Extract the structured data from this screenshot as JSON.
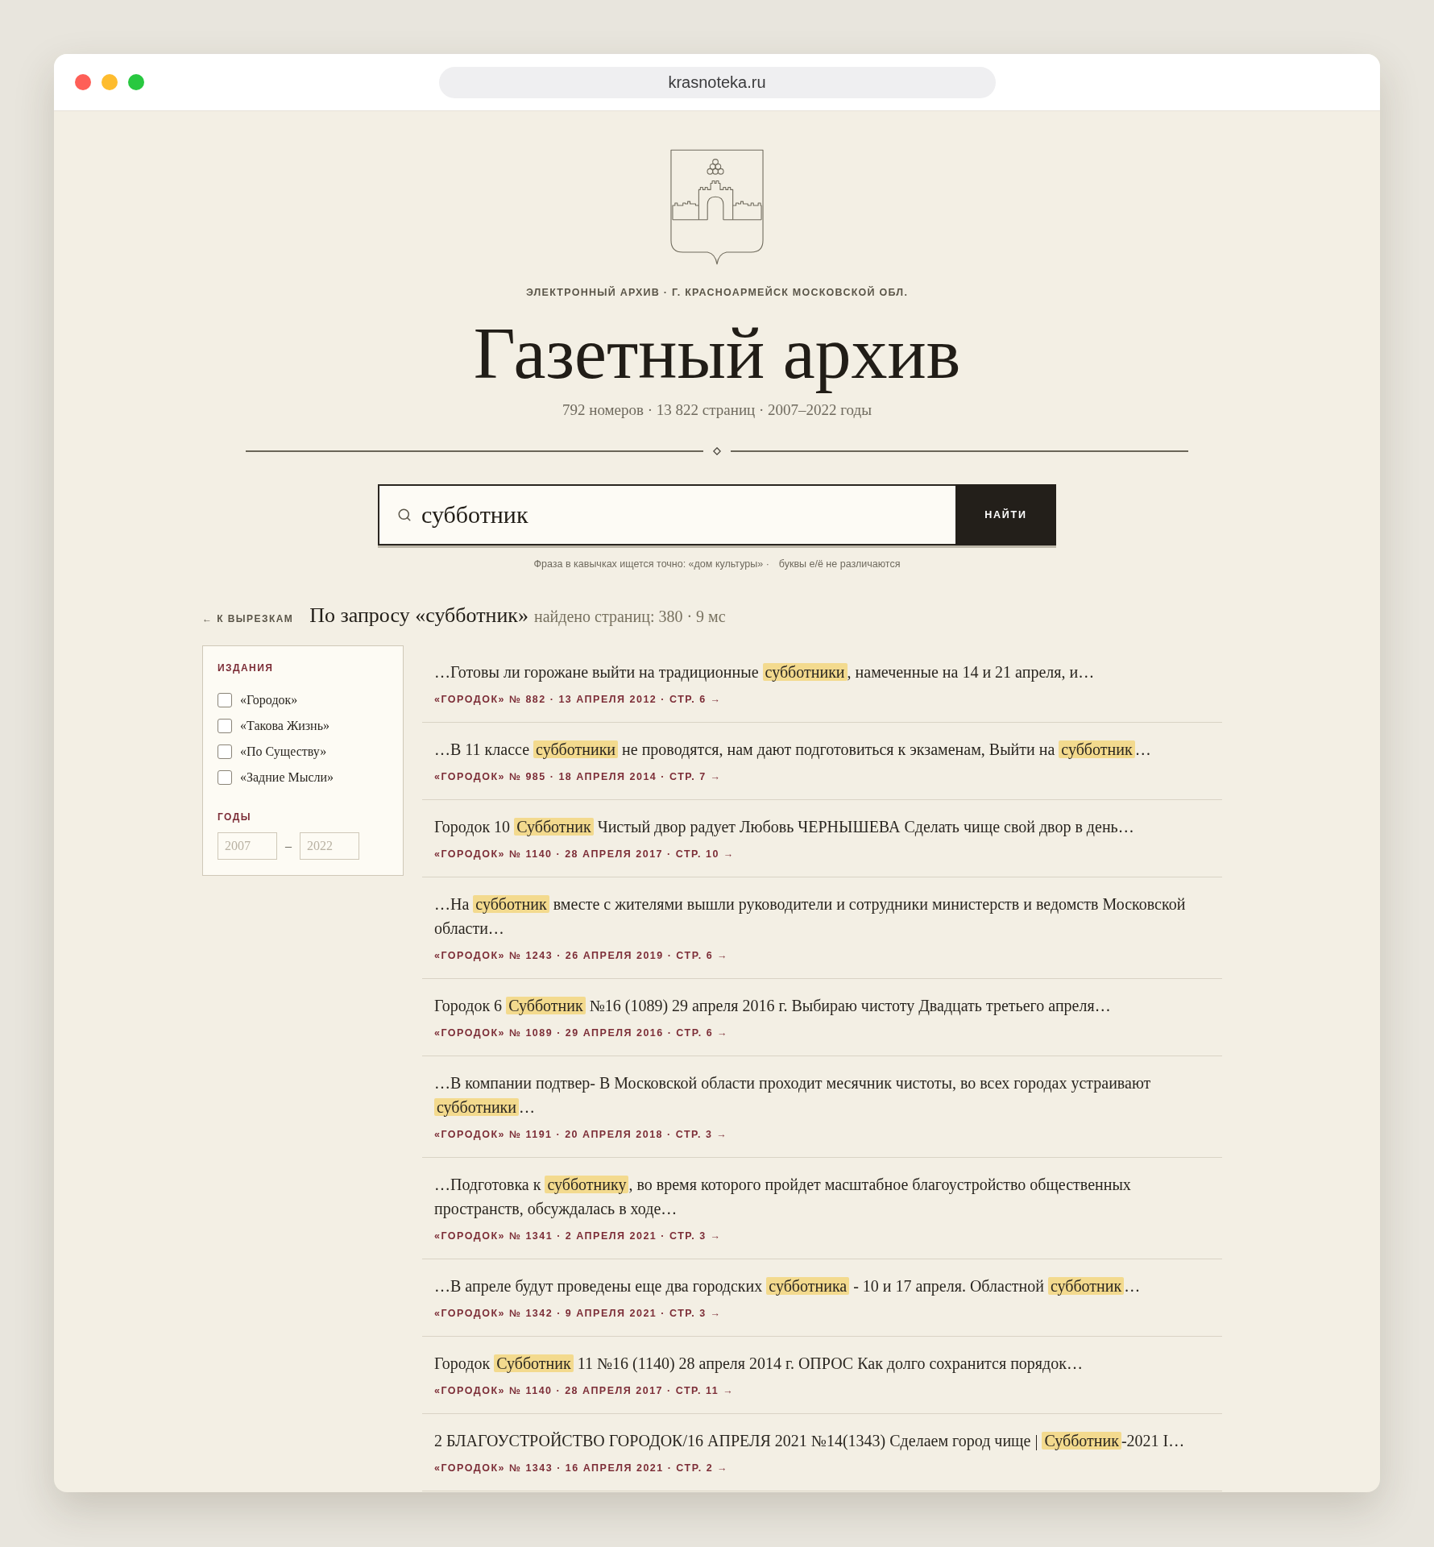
{
  "browser": {
    "url": "krasnoteka.ru"
  },
  "header": {
    "eyebrow": "ЭЛЕКТРОННЫЙ АРХИВ · Г. КРАСНОАРМЕЙСК МОСКОВСКОЙ ОБЛ.",
    "title": "Газетный архив",
    "stats": "792 номеров · 13 822 страниц · 2007–2022 годы"
  },
  "search": {
    "value": "субботник",
    "button": "НАЙТИ",
    "hints": [
      "Фраза в кавычках ищется точно: «дом культуры» ·",
      "буквы е/ё не различаются"
    ]
  },
  "results_header": {
    "back_link": "← К ВЫРЕЗКАМ",
    "query": "По запросу «субботник»",
    "summary": "найдено страниц: 380 · 9 мс"
  },
  "filters": {
    "publications": {
      "heading": "ИЗДАНИЯ",
      "items": [
        {
          "label": "«Городок»",
          "checked": false
        },
        {
          "label": "«Такова Жизнь»",
          "checked": false
        },
        {
          "label": "«По Существу»",
          "checked": false
        },
        {
          "label": "«Задние Мысли»",
          "checked": false
        }
      ]
    },
    "years": {
      "heading": "ГОДЫ",
      "from": {
        "placeholder": "2007"
      },
      "separator": "–",
      "to": {
        "placeholder": "2022"
      }
    }
  },
  "results": [
    {
      "snippet": [
        {
          "text": "…Готовы ли горожане выйти на традиционные ",
          "highlight": false
        },
        {
          "text": "субботники",
          "highlight": true
        },
        {
          "text": ", намеченные на 14 и 21 апреля, и…",
          "highlight": false
        }
      ],
      "source": "«ГОРОДОК» № 882 · 13 АПРЕЛЯ 2012 · СТР. 6 →"
    },
    {
      "snippet": [
        {
          "text": "…В 11 классе ",
          "highlight": false
        },
        {
          "text": "субботники",
          "highlight": true
        },
        {
          "text": " не проводятся, нам дают подготовиться к экзаменам, Выйти на ",
          "highlight": false
        },
        {
          "text": "субботник",
          "highlight": true
        },
        {
          "text": "…",
          "highlight": false
        }
      ],
      "source": "«ГОРОДОК» № 985 · 18 АПРЕЛЯ 2014 · СТР. 7 →"
    },
    {
      "snippet": [
        {
          "text": "Городок 10 ",
          "highlight": false
        },
        {
          "text": "Субботник",
          "highlight": true
        },
        {
          "text": " Чистый двор радует Любовь ЧЕРНЫШЕВА Сделать чище свой двор в день…",
          "highlight": false
        }
      ],
      "source": "«ГОРОДОК» № 1140 · 28 АПРЕЛЯ 2017 · СТР. 10 →"
    },
    {
      "snippet": [
        {
          "text": "…На ",
          "highlight": false
        },
        {
          "text": "субботник",
          "highlight": true
        },
        {
          "text": " вместе с жителями вышли руководители и сотрудники министерств и ведомств Московской области…",
          "highlight": false
        }
      ],
      "source": "«ГОРОДОК» № 1243 · 26 АПРЕЛЯ 2019 · СТР. 6 →"
    },
    {
      "snippet": [
        {
          "text": "Городок 6 ",
          "highlight": false
        },
        {
          "text": "Субботник",
          "highlight": true
        },
        {
          "text": " №16 (1089) 29 апреля 2016 г. Выбираю чистоту Двадцать третьего апреля…",
          "highlight": false
        }
      ],
      "source": "«ГОРОДОК» № 1089 · 29 АПРЕЛЯ 2016 · СТР. 6 →"
    },
    {
      "snippet": [
        {
          "text": "…В компании подтвер- В Московской области проходит месячник чистоты, во всех городах устраивают ",
          "highlight": false
        },
        {
          "text": "субботники",
          "highlight": true
        },
        {
          "text": "…",
          "highlight": false
        }
      ],
      "source": "«ГОРОДОК» № 1191 · 20 АПРЕЛЯ 2018 · СТР. 3 →"
    },
    {
      "snippet": [
        {
          "text": "…Подготовка к ",
          "highlight": false
        },
        {
          "text": "субботнику",
          "highlight": true
        },
        {
          "text": ", во время которого пройдет масштабное благоустройство общественных пространств, обсуждалась в ходе…",
          "highlight": false
        }
      ],
      "source": "«ГОРОДОК» № 1341 · 2 АПРЕЛЯ 2021 · СТР. 3 →"
    },
    {
      "snippet": [
        {
          "text": "…В апреле будут проведены еще два городских ",
          "highlight": false
        },
        {
          "text": "субботника",
          "highlight": true
        },
        {
          "text": " - 10 и 17 апреля. Областной ",
          "highlight": false
        },
        {
          "text": "субботник",
          "highlight": true
        },
        {
          "text": "…",
          "highlight": false
        }
      ],
      "source": "«ГОРОДОК» № 1342 · 9 АПРЕЛЯ 2021 · СТР. 3 →"
    },
    {
      "snippet": [
        {
          "text": "Городок ",
          "highlight": false
        },
        {
          "text": "Субботник",
          "highlight": true
        },
        {
          "text": " 11 №16 (1140) 28 апреля 2014 г. ОПРОС Как долго сохранится порядок…",
          "highlight": false
        }
      ],
      "source": "«ГОРОДОК» № 1140 · 28 АПРЕЛЯ 2017 · СТР. 11 →"
    },
    {
      "snippet": [
        {
          "text": "2 БЛАГОУСТРОЙСТВО ГОРОДОК/16 АПРЕЛЯ 2021 №14(1343) Сделаем город чище | ",
          "highlight": false
        },
        {
          "text": "Субботник",
          "highlight": true
        },
        {
          "text": "-2021 I…",
          "highlight": false
        }
      ],
      "source": "«ГОРОДОК» № 1343 · 16 АПРЕЛЯ 2021 · СТР. 2 →"
    }
  ]
}
